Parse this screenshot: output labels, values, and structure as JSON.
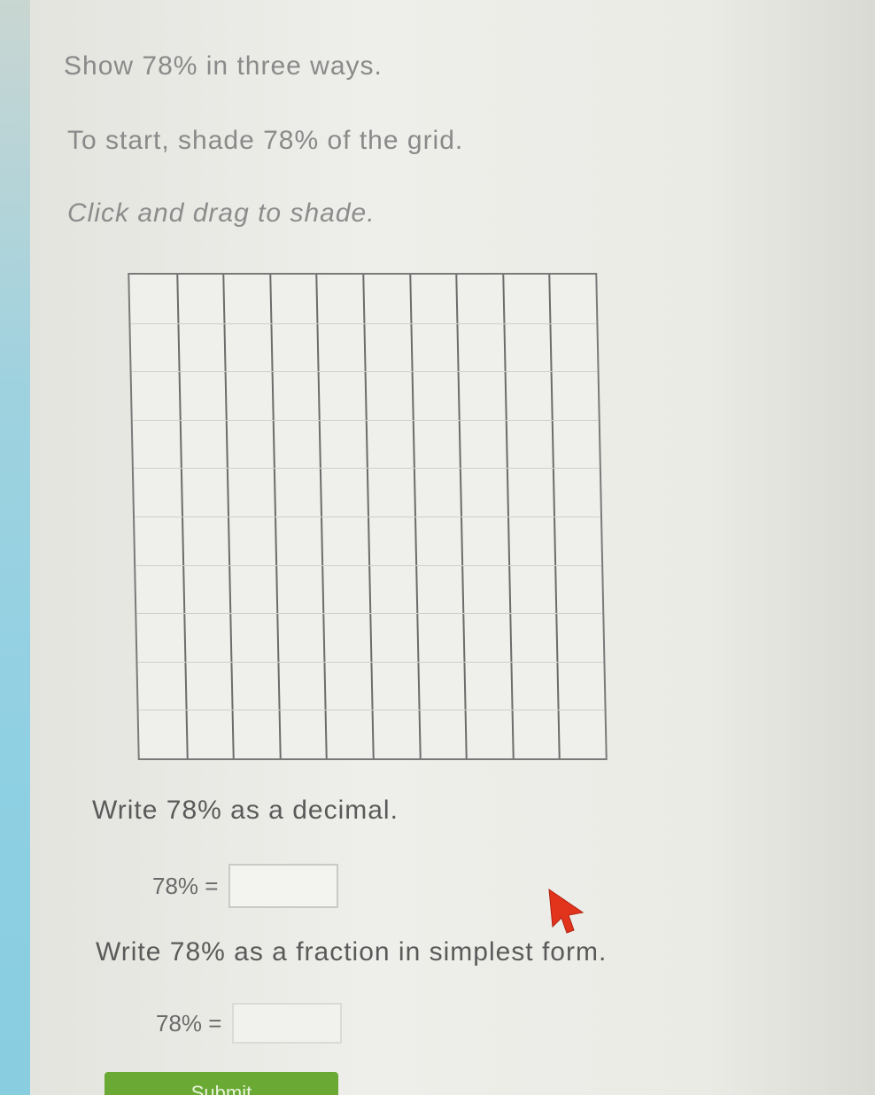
{
  "instructions": {
    "title": "Show 78% in three ways.",
    "start": "To start, shade 78% of the grid.",
    "hint": "Click and drag to shade."
  },
  "grid": {
    "rows": 10,
    "columns": 10,
    "shaded_cells": 0
  },
  "question_decimal": {
    "prompt": "Write 78% as a decimal.",
    "lhs": "78% =",
    "value": ""
  },
  "question_fraction": {
    "prompt": "Write 78% as a fraction in simplest form.",
    "lhs": "78% =",
    "value": ""
  },
  "submit": {
    "label": "Submit"
  },
  "colors": {
    "submit_green": "#6aaa34",
    "cursor_red": "#e2341d",
    "side_cyan": "#8fd0e3"
  },
  "icons": {
    "cursor": "mouse-pointer-icon"
  }
}
